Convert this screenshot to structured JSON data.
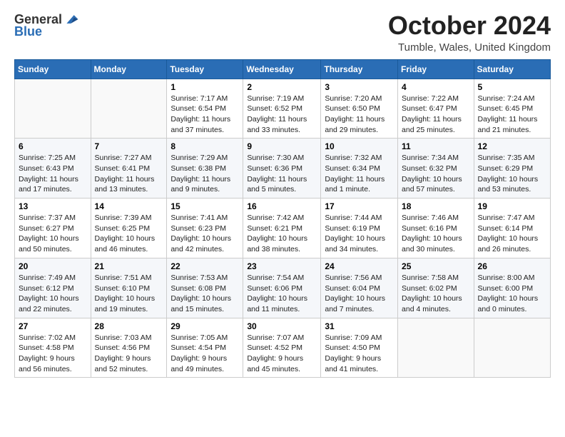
{
  "logo": {
    "line1": "General",
    "line2": "Blue"
  },
  "title": "October 2024",
  "location": "Tumble, Wales, United Kingdom",
  "days_of_week": [
    "Sunday",
    "Monday",
    "Tuesday",
    "Wednesday",
    "Thursday",
    "Friday",
    "Saturday"
  ],
  "weeks": [
    [
      {
        "day": "",
        "info": ""
      },
      {
        "day": "",
        "info": ""
      },
      {
        "day": "1",
        "info": "Sunrise: 7:17 AM\nSunset: 6:54 PM\nDaylight: 11 hours and 37 minutes."
      },
      {
        "day": "2",
        "info": "Sunrise: 7:19 AM\nSunset: 6:52 PM\nDaylight: 11 hours and 33 minutes."
      },
      {
        "day": "3",
        "info": "Sunrise: 7:20 AM\nSunset: 6:50 PM\nDaylight: 11 hours and 29 minutes."
      },
      {
        "day": "4",
        "info": "Sunrise: 7:22 AM\nSunset: 6:47 PM\nDaylight: 11 hours and 25 minutes."
      },
      {
        "day": "5",
        "info": "Sunrise: 7:24 AM\nSunset: 6:45 PM\nDaylight: 11 hours and 21 minutes."
      }
    ],
    [
      {
        "day": "6",
        "info": "Sunrise: 7:25 AM\nSunset: 6:43 PM\nDaylight: 11 hours and 17 minutes."
      },
      {
        "day": "7",
        "info": "Sunrise: 7:27 AM\nSunset: 6:41 PM\nDaylight: 11 hours and 13 minutes."
      },
      {
        "day": "8",
        "info": "Sunrise: 7:29 AM\nSunset: 6:38 PM\nDaylight: 11 hours and 9 minutes."
      },
      {
        "day": "9",
        "info": "Sunrise: 7:30 AM\nSunset: 6:36 PM\nDaylight: 11 hours and 5 minutes."
      },
      {
        "day": "10",
        "info": "Sunrise: 7:32 AM\nSunset: 6:34 PM\nDaylight: 11 hours and 1 minute."
      },
      {
        "day": "11",
        "info": "Sunrise: 7:34 AM\nSunset: 6:32 PM\nDaylight: 10 hours and 57 minutes."
      },
      {
        "day": "12",
        "info": "Sunrise: 7:35 AM\nSunset: 6:29 PM\nDaylight: 10 hours and 53 minutes."
      }
    ],
    [
      {
        "day": "13",
        "info": "Sunrise: 7:37 AM\nSunset: 6:27 PM\nDaylight: 10 hours and 50 minutes."
      },
      {
        "day": "14",
        "info": "Sunrise: 7:39 AM\nSunset: 6:25 PM\nDaylight: 10 hours and 46 minutes."
      },
      {
        "day": "15",
        "info": "Sunrise: 7:41 AM\nSunset: 6:23 PM\nDaylight: 10 hours and 42 minutes."
      },
      {
        "day": "16",
        "info": "Sunrise: 7:42 AM\nSunset: 6:21 PM\nDaylight: 10 hours and 38 minutes."
      },
      {
        "day": "17",
        "info": "Sunrise: 7:44 AM\nSunset: 6:19 PM\nDaylight: 10 hours and 34 minutes."
      },
      {
        "day": "18",
        "info": "Sunrise: 7:46 AM\nSunset: 6:16 PM\nDaylight: 10 hours and 30 minutes."
      },
      {
        "day": "19",
        "info": "Sunrise: 7:47 AM\nSunset: 6:14 PM\nDaylight: 10 hours and 26 minutes."
      }
    ],
    [
      {
        "day": "20",
        "info": "Sunrise: 7:49 AM\nSunset: 6:12 PM\nDaylight: 10 hours and 22 minutes."
      },
      {
        "day": "21",
        "info": "Sunrise: 7:51 AM\nSunset: 6:10 PM\nDaylight: 10 hours and 19 minutes."
      },
      {
        "day": "22",
        "info": "Sunrise: 7:53 AM\nSunset: 6:08 PM\nDaylight: 10 hours and 15 minutes."
      },
      {
        "day": "23",
        "info": "Sunrise: 7:54 AM\nSunset: 6:06 PM\nDaylight: 10 hours and 11 minutes."
      },
      {
        "day": "24",
        "info": "Sunrise: 7:56 AM\nSunset: 6:04 PM\nDaylight: 10 hours and 7 minutes."
      },
      {
        "day": "25",
        "info": "Sunrise: 7:58 AM\nSunset: 6:02 PM\nDaylight: 10 hours and 4 minutes."
      },
      {
        "day": "26",
        "info": "Sunrise: 8:00 AM\nSunset: 6:00 PM\nDaylight: 10 hours and 0 minutes."
      }
    ],
    [
      {
        "day": "27",
        "info": "Sunrise: 7:02 AM\nSunset: 4:58 PM\nDaylight: 9 hours and 56 minutes."
      },
      {
        "day": "28",
        "info": "Sunrise: 7:03 AM\nSunset: 4:56 PM\nDaylight: 9 hours and 52 minutes."
      },
      {
        "day": "29",
        "info": "Sunrise: 7:05 AM\nSunset: 4:54 PM\nDaylight: 9 hours and 49 minutes."
      },
      {
        "day": "30",
        "info": "Sunrise: 7:07 AM\nSunset: 4:52 PM\nDaylight: 9 hours and 45 minutes."
      },
      {
        "day": "31",
        "info": "Sunrise: 7:09 AM\nSunset: 4:50 PM\nDaylight: 9 hours and 41 minutes."
      },
      {
        "day": "",
        "info": ""
      },
      {
        "day": "",
        "info": ""
      }
    ]
  ]
}
